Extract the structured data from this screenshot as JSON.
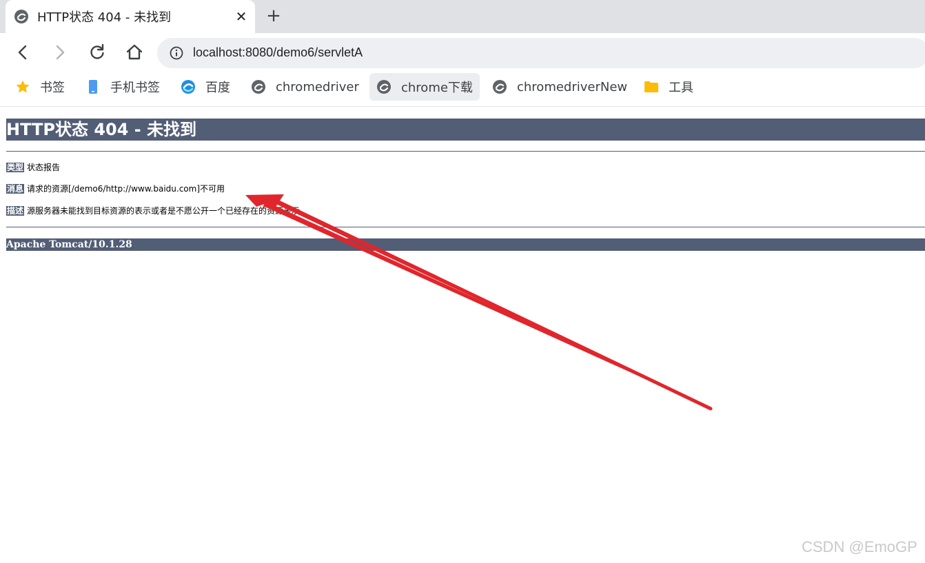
{
  "tab": {
    "title": "HTTP状态 404 - 未找到",
    "close_glyph": "✕",
    "new_tab_glyph": "+"
  },
  "omnibox": {
    "url": "localhost:8080/demo6/servletA"
  },
  "bookmarks": [
    {
      "label": "书签",
      "icon": "star-icon"
    },
    {
      "label": "手机书签",
      "icon": "mobile-icon"
    },
    {
      "label": "百度",
      "icon": "edge-icon"
    },
    {
      "label": "chromedriver",
      "icon": "site-icon"
    },
    {
      "label": "chrome下载",
      "icon": "site-icon"
    },
    {
      "label": "chromedriverNew",
      "icon": "site-icon"
    },
    {
      "label": "工具",
      "icon": "folder-icon"
    }
  ],
  "error_page": {
    "heading": "HTTP状态 404 - 未找到",
    "type_label": "类型",
    "type_value": "状态报告",
    "message_label": "消息",
    "message_value": "请求的资源[/demo6/http://www.baidu.com]不可用",
    "description_label": "描述",
    "description_value": "源服务器未能找到目标资源的表示或者是不愿公开一个已经存在的资源表示。",
    "footer": "Apache Tomcat/10.1.28"
  },
  "watermark": "CSDN @EmoGP",
  "colors": {
    "tomcat_banner": "#525d76",
    "annotation_arrow": "#e0262c",
    "tab_strip": "#dfe1e5"
  }
}
